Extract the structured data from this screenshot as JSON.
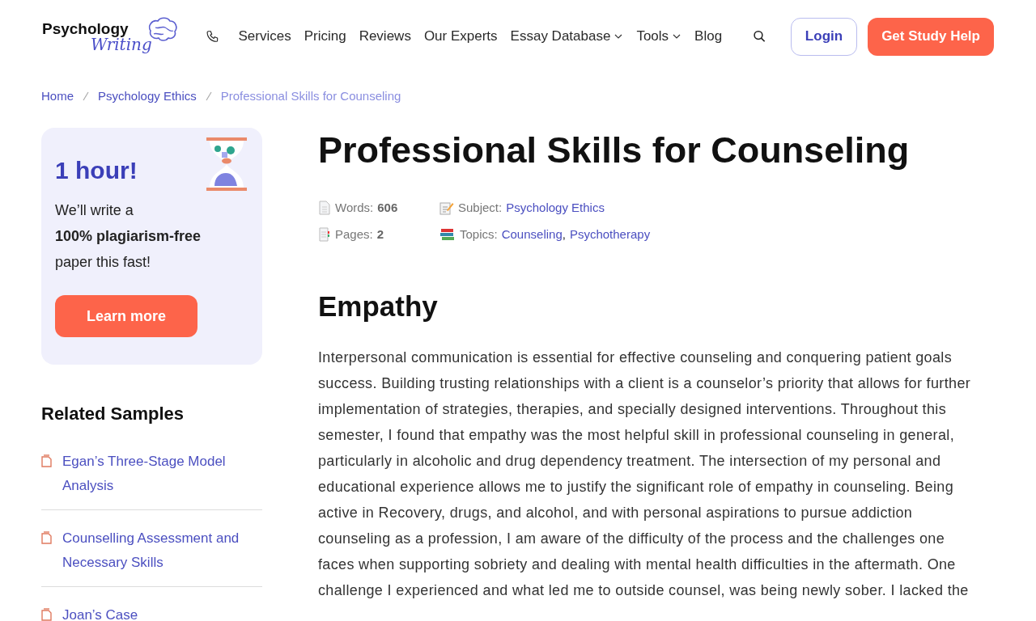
{
  "logo": {
    "line_1": "Psychology",
    "line_2": "Writing"
  },
  "nav": [
    {
      "label": "Services",
      "dropdown": false
    },
    {
      "label": "Pricing",
      "dropdown": false
    },
    {
      "label": "Reviews",
      "dropdown": false
    },
    {
      "label": "Our Experts",
      "dropdown": false
    },
    {
      "label": "Essay Database",
      "dropdown": true
    },
    {
      "label": "Tools",
      "dropdown": true
    },
    {
      "label": "Blog",
      "dropdown": false
    }
  ],
  "login_button": "Login",
  "cta_button": "Get Study Help",
  "breadcrumb": [
    {
      "label": "Home",
      "current": false
    },
    {
      "label": "Psychology Ethics",
      "current": false
    },
    {
      "label": "Professional Skills for Counseling",
      "current": true
    }
  ],
  "promo": {
    "title": "1 hour!",
    "text": "We’ll write a",
    "bold": "100% plagiarism-free",
    "text_2": "paper this fast!",
    "button": "Learn more"
  },
  "related": {
    "title": "Related Samples",
    "items": [
      "Egan’s Three-Stage Model Analysis",
      "Counselling Assessment and Necessary Skills",
      "Joan’s Case"
    ]
  },
  "article": {
    "title": "Professional Skills for Counseling",
    "meta": [
      {
        "kind": "words",
        "label": "Words:",
        "values": [
          "606"
        ]
      },
      {
        "kind": "subject",
        "label": "Subject:",
        "values": [
          "Psychology Ethics"
        ]
      },
      {
        "kind": "pages",
        "label": "Pages:",
        "values": [
          "2"
        ]
      },
      {
        "kind": "topics",
        "label": "Topics:",
        "separator": ",",
        "values": [
          "Counseling",
          "Psychotherapy"
        ]
      }
    ],
    "heading": "Empathy",
    "paragraph": "Interpersonal communication is essential for effective counseling and conquering patient goals success. Building trusting relationships with a client is a counselor’s priority that allows for further implementation of strategies, therapies, and specially designed interventions. Throughout this semester, I found that empathy was the most helpful skill in professional counseling in general, particularly in alcoholic and drug dependency treatment. The intersection of my personal and educational experience allows me to justify the significant role of empathy in counseling. Being active in Recovery, drugs, and alcohol, and with personal aspirations to pursue addiction counseling as a profession, I am aware of the difficulty of the process and the challenges one faces when supporting sobriety and dealing with mental health difficulties in the aftermath. One challenge I experienced and what led me to outside counsel, was being newly sober. I lacked the"
  }
}
